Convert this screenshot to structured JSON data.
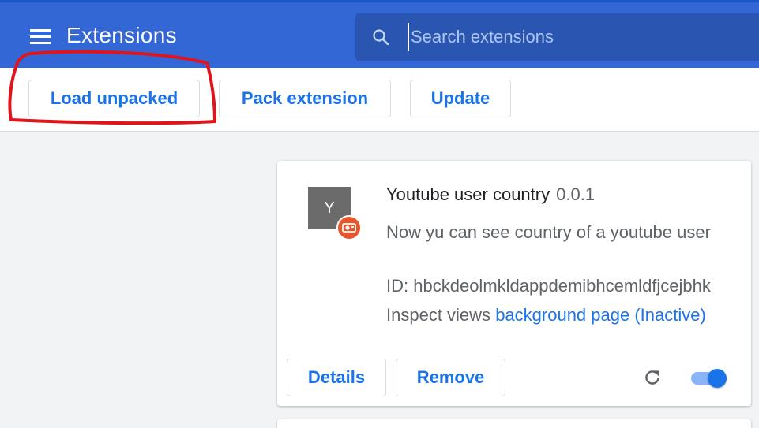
{
  "header": {
    "title": "Extensions",
    "search_placeholder": "Search extensions"
  },
  "toolbar": {
    "load_unpacked": "Load unpacked",
    "pack_extension": "Pack extension",
    "update": "Update"
  },
  "extension": {
    "icon_letter": "Y",
    "name": "Youtube user country",
    "version": "0.0.1",
    "description": "Now yu can see country of a youtube user",
    "id_label": "ID:",
    "id_value": "hbckdeolmkldappdemibhcemldfjcejbhk",
    "inspect_label": "Inspect views",
    "inspect_link": "background page (Inactive)",
    "details_label": "Details",
    "remove_label": "Remove",
    "enabled": true
  },
  "colors": {
    "header": "#3367d6",
    "accent": "#1a73e8",
    "annotation": "#e0141b"
  },
  "icons": [
    "menu-icon",
    "search-icon",
    "reload-icon",
    "extension-badge-icon"
  ]
}
